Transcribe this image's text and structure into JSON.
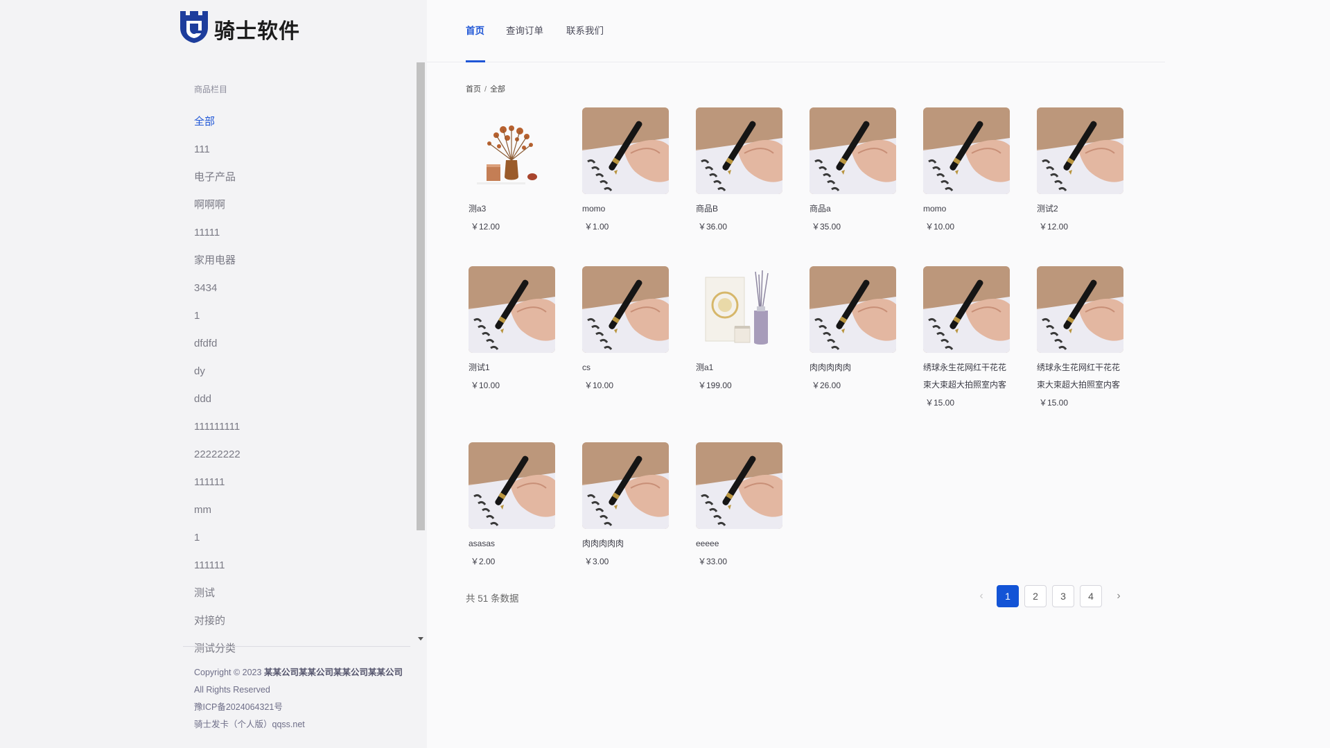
{
  "brand": {
    "name": "骑士软件"
  },
  "nav": {
    "items": [
      {
        "label": "首页",
        "active": true
      },
      {
        "label": "查询订单",
        "active": false
      },
      {
        "label": "联系我们",
        "active": false
      }
    ]
  },
  "sidebar": {
    "title": "商品栏目",
    "categories": [
      "全部",
      "111",
      "电子产品",
      "啊啊啊",
      "11111",
      "家用电器",
      "3434",
      "1",
      "dfdfd",
      "dy",
      "ddd",
      "111111111",
      "22222222",
      "111111",
      "mm",
      "1",
      "111111",
      "测试",
      "对接的",
      "测试分类"
    ],
    "active_index": 0
  },
  "footer": {
    "copyright_prefix": "Copyright © 2023",
    "company": "某某公司某某公司某某公司某某公司",
    "rights": "All Rights Reserved",
    "icp": "豫ICP备2024064321号",
    "powered": "骑士发卡（个人版）qqss.net"
  },
  "breadcrumb": {
    "home": "首页",
    "separator": "/",
    "current": "全部"
  },
  "products": [
    {
      "name": "测a3",
      "price": "￥12.00",
      "image": "vase"
    },
    {
      "name": "momo",
      "price": "￥1.00",
      "image": "pen"
    },
    {
      "name": "商品B",
      "price": "￥36.00",
      "image": "pen"
    },
    {
      "name": "商品a",
      "price": "￥35.00",
      "image": "pen"
    },
    {
      "name": "momo",
      "price": "￥10.00",
      "image": "pen"
    },
    {
      "name": "测试2",
      "price": "￥12.00",
      "image": "pen"
    },
    {
      "name": "测试1",
      "price": "￥10.00",
      "image": "pen"
    },
    {
      "name": "cs",
      "price": "￥10.00",
      "image": "pen"
    },
    {
      "name": "测a1",
      "price": "￥199.00",
      "image": "diffuser"
    },
    {
      "name": "肉肉肉肉肉",
      "price": "￥26.00",
      "image": "pen"
    },
    {
      "name": "绣球永生花网红干花花束大束超大拍照室内客",
      "price": "￥15.00",
      "image": "pen"
    },
    {
      "name": "绣球永生花网红干花花束大束超大拍照室内客",
      "price": "￥15.00",
      "image": "pen"
    },
    {
      "name": "asasas",
      "price": "￥2.00",
      "image": "pen"
    },
    {
      "name": "肉肉肉肉肉",
      "price": "￥3.00",
      "image": "pen"
    },
    {
      "name": "eeeee",
      "price": "￥33.00",
      "image": "pen"
    }
  ],
  "pagination": {
    "total_text": "共 51 条数据",
    "pages": [
      "1",
      "2",
      "3",
      "4"
    ],
    "current": "1",
    "prev_icon": "chevron-left-icon",
    "next_icon": "chevron-right-icon"
  },
  "colors": {
    "accent": "#1f56d6",
    "active_page": "#1354d6"
  }
}
